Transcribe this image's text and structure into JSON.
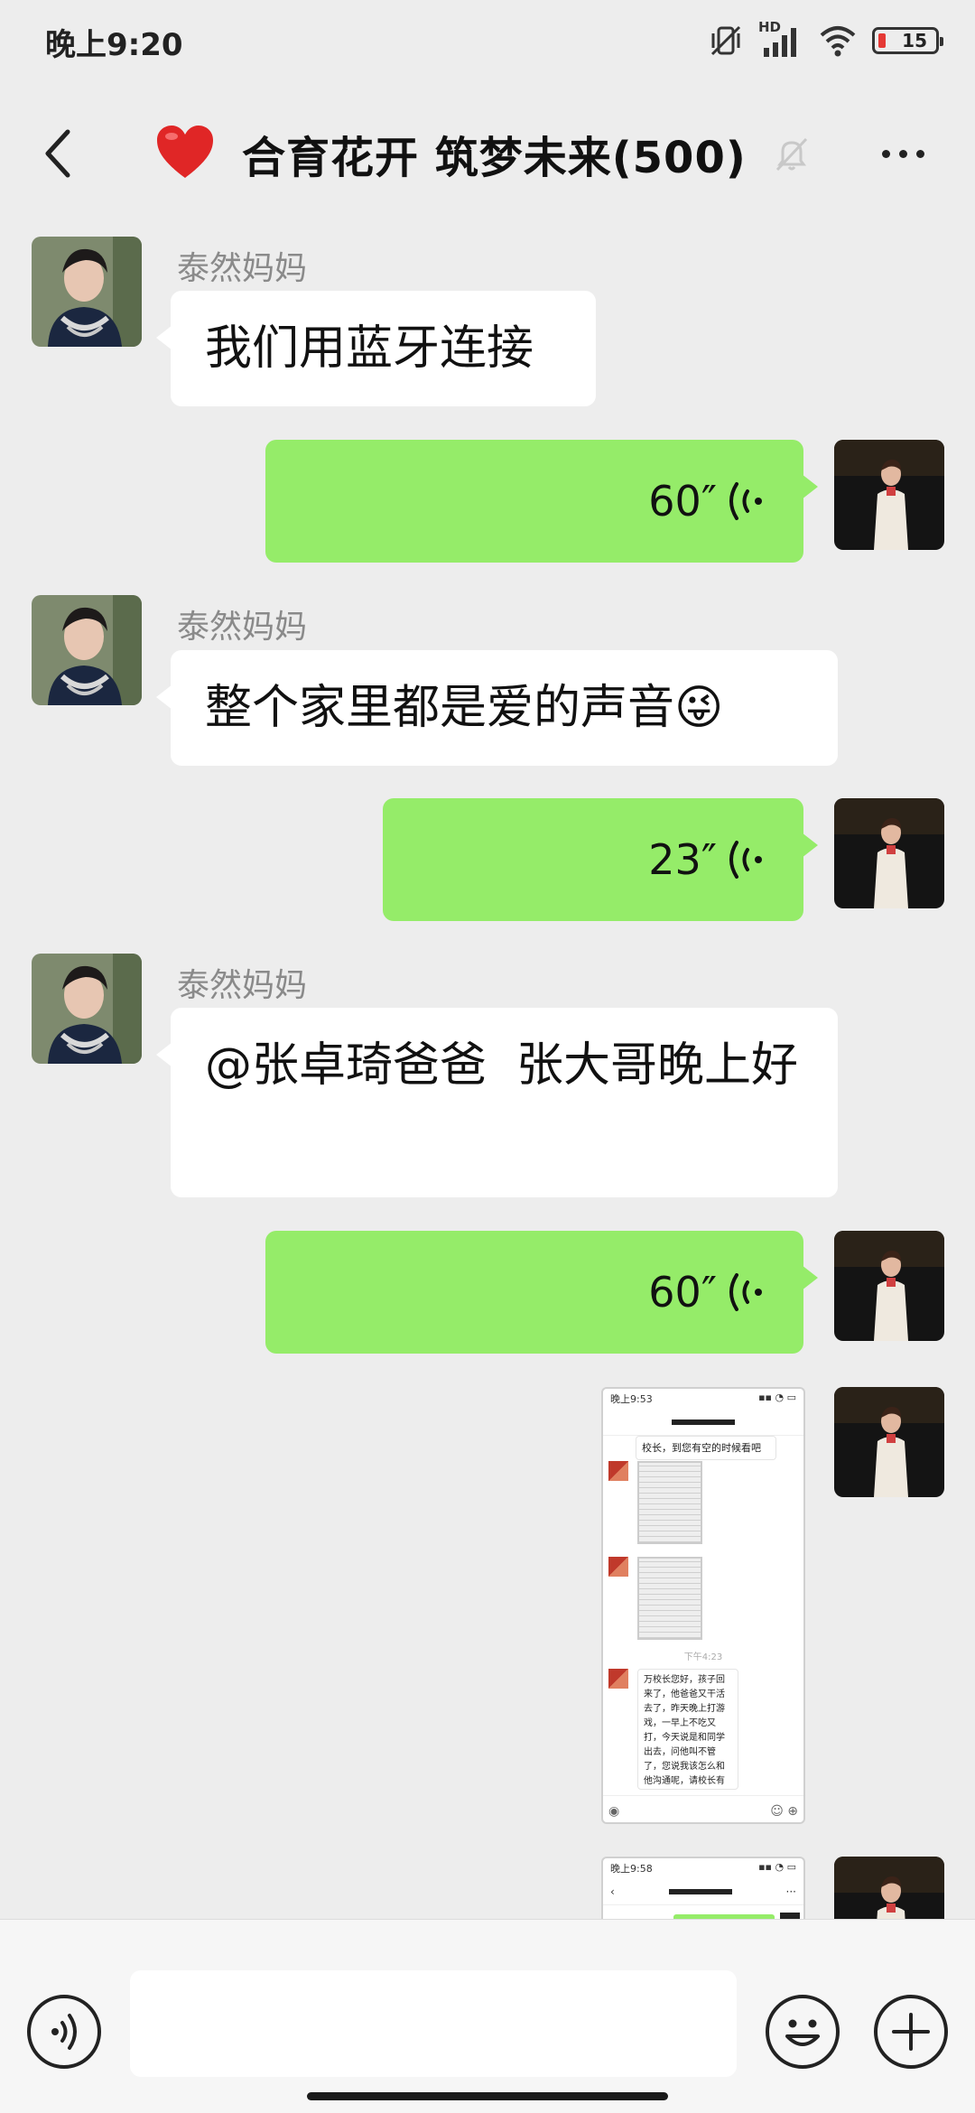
{
  "status": {
    "time": "晚上9:20",
    "network": "HD",
    "battery": "15"
  },
  "header": {
    "title": "合育花开 筑梦未来(500)"
  },
  "messages": [
    {
      "side": "left",
      "sender": "泰然妈妈",
      "text": "我们用蓝牙连接"
    },
    {
      "side": "right",
      "type": "voice",
      "duration": "60″"
    },
    {
      "side": "left",
      "sender": "泰然妈妈",
      "text": "整个家里都是爱的声音😜"
    },
    {
      "side": "right",
      "type": "voice",
      "duration": "23″"
    },
    {
      "side": "left",
      "sender": "泰然妈妈",
      "text": "@张卓琦爸爸  张大哥晚上好"
    },
    {
      "side": "right",
      "type": "voice",
      "duration": "60″"
    },
    {
      "side": "right",
      "type": "image"
    },
    {
      "side": "right",
      "type": "image"
    }
  ],
  "screenshot1": {
    "time": "晚上9:53",
    "bubble_top": "校长，到您有空的时候看吧",
    "timestamp": "下午4:23",
    "bubble_main": "万校长您好，孩子回来了，他爸爸又干活去了，昨天晚上打游戏，一早上不吃又打，今天说是和同学出去，问他叫不管了，您说我该怎么和他沟通呢，请校长有空的时候指教，谢谢。"
  },
  "screenshot2": {
    "time": "晚上9:58"
  },
  "input": {
    "placeholder": ""
  },
  "icons": {
    "back": "chevron-left-icon",
    "heart": "heart-icon",
    "mute": "bell-off-icon",
    "more": "more-dots-icon",
    "voice_msg": "voice-wave-icon",
    "voice_toggle": "voice-input-icon",
    "emoji": "emoji-icon",
    "plus": "plus-icon"
  }
}
